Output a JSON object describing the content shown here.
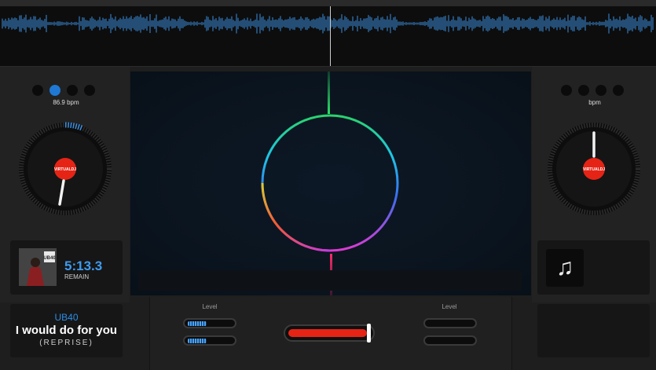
{
  "deck_left": {
    "bpm_label": "86.9 bpm",
    "time": "5:13.3",
    "time_mode": "REMAIN",
    "track_artist": "UB40",
    "track_title": "I would do for you",
    "track_subtitle": "(REPRISE)",
    "platter_label": "VIRTUALDJ",
    "album_art_text": "UB40",
    "beat_dots": [
      false,
      true,
      false,
      false
    ]
  },
  "deck_right": {
    "bpm_label": "bpm",
    "platter_label": "VIRTUALDJ",
    "placeholder_icon": "music-note-icon",
    "beat_dots": [
      false,
      false,
      false,
      false
    ]
  },
  "mixer": {
    "left_level_label": "Level",
    "right_level_label": "Level",
    "left_levels": [
      0.42,
      0.42
    ],
    "right_levels": [
      0,
      0
    ],
    "crossfader_position": 1.0
  },
  "colors": {
    "accent_blue": "#1e78d4",
    "platter_red": "#e52416",
    "waveform_blue": "#3b8fe0"
  }
}
